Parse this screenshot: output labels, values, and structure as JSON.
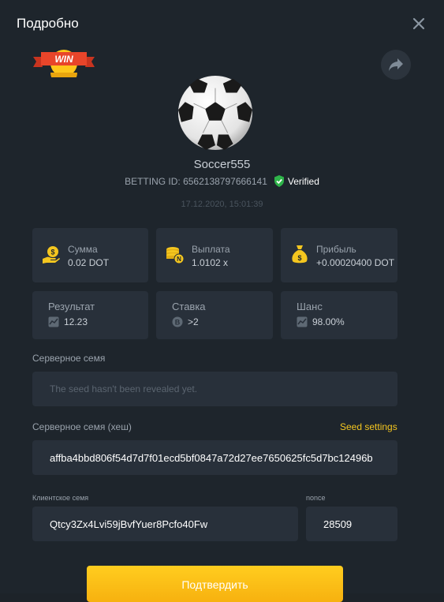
{
  "header": {
    "title": "Подробно"
  },
  "badge": {
    "text": "WIN"
  },
  "game": {
    "username": "Soccer555",
    "betting_id": "BETTING ID: 6562138797666141",
    "verified": "Verified",
    "datetime": "17.12.2020, 15:01:39"
  },
  "stats": [
    {
      "label": "Сумма",
      "value": "0.02 DOT",
      "icon": "coin-hand-icon"
    },
    {
      "label": "Выплата",
      "value": "1.0102 x",
      "icon": "coin-stack-icon"
    },
    {
      "label": "Прибыль",
      "value": "+0.00020400 DOT",
      "icon": "money-bag-icon"
    },
    {
      "label": "Результат",
      "value": "12.23",
      "icon": "result-icon"
    },
    {
      "label": "Ставка",
      "value": ">2",
      "icon": "bet-icon"
    },
    {
      "label": "Шанс",
      "value": "98.00%",
      "icon": "chance-icon"
    }
  ],
  "server_seed": {
    "label": "Серверное семя",
    "placeholder": "The seed hasn't been revealed yet."
  },
  "server_seed_hash": {
    "label": "Серверное семя (хеш)",
    "value": "affba4bbd806f54d7d7f01ecd5bf0847a72d27ee7650625fc5d7bc12496b",
    "settings_link": "Seed settings"
  },
  "client_seed": {
    "label": "Клиентское семя",
    "value": "Qtcy3Zx4Lvi59jBvfYuer8Pcfo40Fw"
  },
  "nonce": {
    "label": "nonce",
    "value": "28509"
  },
  "actions": {
    "confirm": "Подтвердить"
  },
  "colors": {
    "accent": "#f4c61f",
    "verified": "#2fb44a",
    "card": "#28303a",
    "background": "#1e252c"
  }
}
